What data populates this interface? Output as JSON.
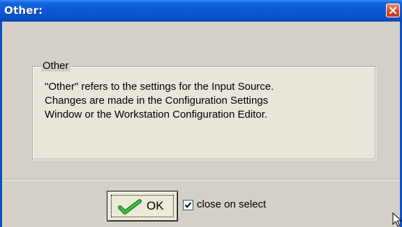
{
  "window": {
    "title": "Other:"
  },
  "group": {
    "legend": "Other",
    "lines": [
      "\"Other\" refers to the settings for the Input Source.",
      "Changes are made in the Configuration Settings",
      "Window or the Workstation Configuration Editor."
    ]
  },
  "footer": {
    "ok_label": "OK",
    "close_on_select_label": "close on select",
    "close_on_select_checked": true
  },
  "icons": {
    "close": "close-icon",
    "ok": "green-check-icon",
    "cursor": "mouse-pointer-icon"
  },
  "colors": {
    "titlebar": "#0a58d4",
    "close": "#d8451e",
    "check": "#2e9a2e"
  }
}
